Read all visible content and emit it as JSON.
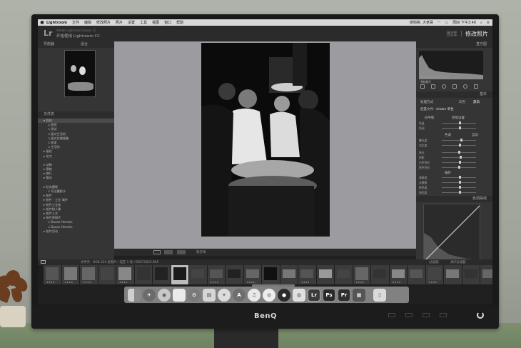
{
  "menubar": {
    "app_name": "Lightroom",
    "items": [
      "文件",
      "编辑",
      "修改照片",
      "照片",
      "设置",
      "工具",
      "视图",
      "窗口",
      "帮助"
    ],
    "right_text": "搜狗拼, 大老哥",
    "clock": "周四 下午3:48"
  },
  "identity": {
    "logo": "Lr",
    "line1": "Adobe Lightroom Classic CC",
    "line2": "开始使用 Lightroom CC"
  },
  "modules": {
    "library": "图库",
    "separator": "|",
    "develop": "修改照片"
  },
  "left_panel": {
    "navigator_title": "导航器",
    "navigator_zoom": "适合",
    "folders_header": "文件夹",
    "folders": [
      {
        "label": "▾ 我的",
        "level": 0,
        "selected": true
      },
      {
        "label": "▫ 昂然",
        "level": 1
      },
      {
        "label": "▫ 测试",
        "level": 1
      },
      {
        "label": "▫ 面对生活的",
        "level": 1
      },
      {
        "label": "▫ 面对比喻镜像",
        "level": 1
      },
      {
        "label": "▫ 样家",
        "level": 1
      },
      {
        "label": "▫ 生活的",
        "level": 1
      },
      {
        "label": "▸ 烟花",
        "level": 0
      },
      {
        "label": "▸ 名力",
        "level": 0
      },
      {
        "label": "",
        "level": 0
      },
      {
        "label": "▸ 动物",
        "level": 0
      },
      {
        "label": "▸ 建筑",
        "level": 0
      },
      {
        "label": "▸ 旅行",
        "level": 0
      },
      {
        "label": "▸ 猫岛",
        "level": 0
      },
      {
        "label": "",
        "level": 0
      },
      {
        "label": "▸ 纪实摄影",
        "level": 0
      },
      {
        "label": "▫ 司法摄影沙",
        "level": 1
      },
      {
        "label": "▸ 拍片",
        "level": 0
      },
      {
        "label": "▸ 拍片 - 工业 城乡",
        "level": 0
      },
      {
        "label": "▸ 拍片工业化",
        "level": 0
      },
      {
        "label": "▸ 拍片拍人像",
        "level": 0
      },
      {
        "label": "▸ 拍片人文",
        "level": 0
      },
      {
        "label": "▸ 拍片原照片",
        "level": 0
      },
      {
        "label": "▫ Dusan Hendes",
        "level": 1
      },
      {
        "label": "▫ Dusan Hendes",
        "level": 1
      },
      {
        "label": "▸ 拍片活动",
        "level": 0
      }
    ],
    "import_button": "导入...",
    "export_button": "导出..."
  },
  "toolbar": {
    "softproof": "软打样"
  },
  "right_panel": {
    "histogram_title": "直方图",
    "histogram_info": "ISO 1600   50 mm   f/1.2",
    "original_label": "原始照片",
    "basic_title": "基本",
    "treatment_label": "处理方式",
    "color_label": "彩色",
    "bw_label": "黑白",
    "profile_label": "配置文件:",
    "profile_value": "Adobe 单色",
    "wb_label": "白平衡",
    "wb_value": "原照设置",
    "sliders_wb": [
      "色温",
      "色调"
    ],
    "tone_label": "色调",
    "auto_label": "自动",
    "sliders_tone": [
      "曝光度",
      "对比度",
      "高光",
      "阴影",
      "白色色阶",
      "黑色色阶"
    ],
    "presence_label": "偏好",
    "sliders_presence": [
      "清晰度",
      "去朦胧",
      "鲜艳度",
      "饱和度"
    ],
    "tone_curve_title": "色调曲线",
    "prev_button": "上一张",
    "reset_button": "复位"
  },
  "filmstrip_bar": {
    "info": "文件夹：HOK  220 张照片 / 选定 1 张 / DSCF1625.RAF",
    "filter_label": "过滤器：",
    "filter_value": "关闭过滤器"
  },
  "dock": {
    "icons": [
      "finder-icon",
      "launchpad-icon",
      "chrome-icon",
      "notes-icon",
      "system-prefs-icon",
      "preview-icon",
      "safari-icon",
      "appstore-icon",
      "itunes-icon",
      "screen-recorder-icon",
      "penguin-icon",
      "wechat-icon",
      "lightroom-icon",
      "photoshop-icon",
      "premiere-icon",
      "clapper-icon",
      "trash-icon"
    ],
    "lr": "Lr",
    "ps": "Ps",
    "pr": "Pr"
  },
  "monitor": {
    "brand": "BenQ"
  }
}
